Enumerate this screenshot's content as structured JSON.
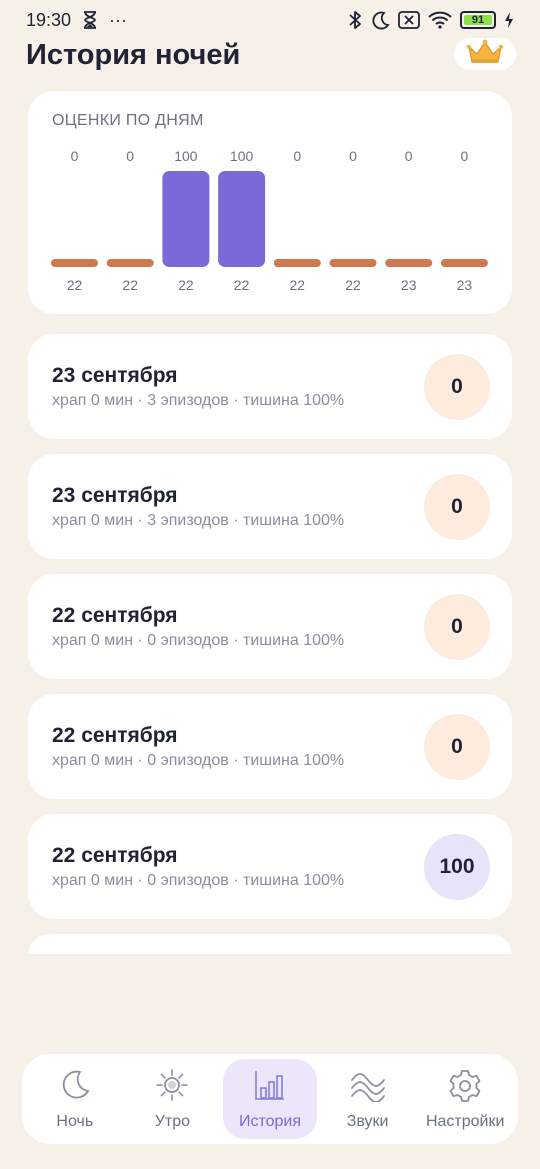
{
  "status_bar": {
    "time": "19:30",
    "dots": "···",
    "battery": "91",
    "icons": [
      "hourglass-icon",
      "bluetooth-icon",
      "moon-icon",
      "sim-off-icon",
      "wifi-icon",
      "battery-icon",
      "charging-icon"
    ]
  },
  "header": {
    "title": "История ночей",
    "premium_icon": "crown-icon"
  },
  "chart_data": {
    "type": "bar",
    "title": "ОЦЕНКИ ПО ДНЯМ",
    "categories": [
      "22",
      "22",
      "22",
      "22",
      "22",
      "22",
      "23",
      "23"
    ],
    "values": [
      0,
      0,
      100,
      100,
      0,
      0,
      0,
      0
    ],
    "ylim": [
      0,
      100
    ],
    "colors": {
      "high": "#7b68d9",
      "zero": "#cf7a4e"
    }
  },
  "nights": [
    {
      "date": "23 сентября",
      "stats": "храп 0 мин · 3 эпизодов · тишина 100%",
      "score": "0",
      "level": "low"
    },
    {
      "date": "23 сентября",
      "stats": "храп 0 мин · 3 эпизодов · тишина 100%",
      "score": "0",
      "level": "low"
    },
    {
      "date": "22 сентября",
      "stats": "храп 0 мин · 0 эпизодов · тишина 100%",
      "score": "0",
      "level": "low"
    },
    {
      "date": "22 сентября",
      "stats": "храп 0 мин · 0 эпизодов · тишина 100%",
      "score": "0",
      "level": "low"
    },
    {
      "date": "22 сентября",
      "stats": "храп 0 мин · 0 эпизодов · тишина 100%",
      "score": "100",
      "level": "high"
    }
  ],
  "nav": {
    "items": [
      {
        "label": "Ночь",
        "icon": "moon-icon",
        "active": false
      },
      {
        "label": "Утро",
        "icon": "sun-icon",
        "active": false
      },
      {
        "label": "История",
        "icon": "bar-chart-icon",
        "active": true
      },
      {
        "label": "Звуки",
        "icon": "waves-icon",
        "active": false
      },
      {
        "label": "Настройки",
        "icon": "gear-icon",
        "active": false
      }
    ]
  }
}
